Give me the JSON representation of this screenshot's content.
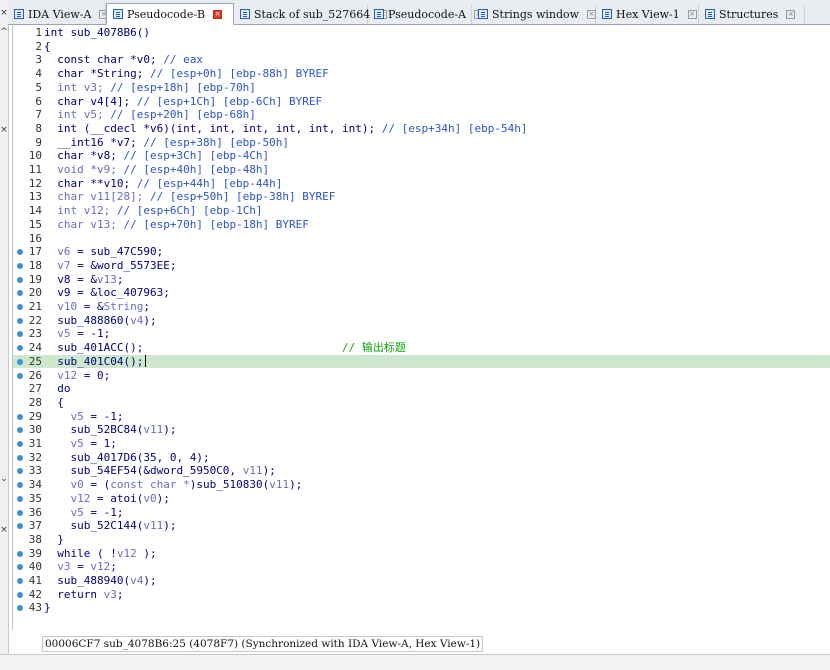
{
  "left_marks": [
    "×",
    "^",
    "×",
    "⌄",
    "×"
  ],
  "tabs": [
    {
      "label": "IDA View-A",
      "active": false
    },
    {
      "label": "Pseudocode-B",
      "active": true
    },
    {
      "label": "Stack of sub_527664",
      "active": false
    },
    {
      "label": "Pseudocode-A",
      "active": false
    },
    {
      "label": "Strings window",
      "active": false
    },
    {
      "label": "Hex View-1",
      "active": false
    },
    {
      "label": "Structures",
      "active": false
    }
  ],
  "code_lines": [
    {
      "n": "1",
      "dot": false,
      "segs": [
        [
          "d",
          "int sub_4078B6()"
        ]
      ]
    },
    {
      "n": "2",
      "dot": false,
      "segs": [
        [
          "d",
          "{"
        ]
      ]
    },
    {
      "n": "3",
      "dot": false,
      "segs": [
        [
          "d",
          "  const char *v0; "
        ],
        [
          "c",
          "// eax"
        ]
      ]
    },
    {
      "n": "4",
      "dot": false,
      "segs": [
        [
          "d",
          "  char *String; "
        ],
        [
          "c",
          "// [esp+0h] [ebp-88h] BYREF"
        ]
      ]
    },
    {
      "n": "5",
      "dot": false,
      "segs": [
        [
          "v",
          "  int v3; "
        ],
        [
          "c",
          "// [esp+18h] [ebp-70h]"
        ]
      ]
    },
    {
      "n": "6",
      "dot": false,
      "segs": [
        [
          "d",
          "  char v4[4]; "
        ],
        [
          "c",
          "// [esp+1Ch] [ebp-6Ch] BYREF"
        ]
      ]
    },
    {
      "n": "7",
      "dot": false,
      "segs": [
        [
          "v",
          "  int v5; "
        ],
        [
          "c",
          "// [esp+20h] [ebp-68h]"
        ]
      ]
    },
    {
      "n": "8",
      "dot": false,
      "segs": [
        [
          "d",
          "  int (__cdecl *v6)(int, int, int, int, int, int); "
        ],
        [
          "c",
          "// [esp+34h] [ebp-54h]"
        ]
      ]
    },
    {
      "n": "9",
      "dot": false,
      "segs": [
        [
          "d",
          "  __int16 *v7; "
        ],
        [
          "c",
          "// [esp+38h] [ebp-50h]"
        ]
      ]
    },
    {
      "n": "10",
      "dot": false,
      "segs": [
        [
          "d",
          "  char *v8; "
        ],
        [
          "c",
          "// [esp+3Ch] [ebp-4Ch]"
        ]
      ]
    },
    {
      "n": "11",
      "dot": false,
      "segs": [
        [
          "v",
          "  void *v9; "
        ],
        [
          "c",
          "// [esp+40h] [ebp-48h]"
        ]
      ]
    },
    {
      "n": "12",
      "dot": false,
      "segs": [
        [
          "d",
          "  char **v10; "
        ],
        [
          "c",
          "// [esp+44h] [ebp-44h]"
        ]
      ]
    },
    {
      "n": "13",
      "dot": false,
      "segs": [
        [
          "v",
          "  char v11[28]; "
        ],
        [
          "c",
          "// [esp+50h] [ebp-38h] BYREF"
        ]
      ]
    },
    {
      "n": "14",
      "dot": false,
      "segs": [
        [
          "v",
          "  int v12; "
        ],
        [
          "c",
          "// [esp+6Ch] [ebp-1Ch]"
        ]
      ]
    },
    {
      "n": "15",
      "dot": false,
      "segs": [
        [
          "v",
          "  char v13; "
        ],
        [
          "c",
          "// [esp+70h] [ebp-18h] BYREF"
        ]
      ]
    },
    {
      "n": "16",
      "dot": false,
      "segs": [
        [
          "d",
          ""
        ]
      ]
    },
    {
      "n": "17",
      "dot": true,
      "segs": [
        [
          "v",
          "  v6"
        ],
        [
          "d",
          " = sub_47C590;"
        ]
      ]
    },
    {
      "n": "18",
      "dot": true,
      "segs": [
        [
          "v",
          "  v7"
        ],
        [
          "d",
          " = &word_5573EE;"
        ]
      ]
    },
    {
      "n": "19",
      "dot": true,
      "segs": [
        [
          "d",
          "  v8 = &"
        ],
        [
          "v",
          "v13"
        ],
        [
          "d",
          ";"
        ]
      ]
    },
    {
      "n": "20",
      "dot": true,
      "segs": [
        [
          "d",
          "  v9 = &loc_407963;"
        ]
      ]
    },
    {
      "n": "21",
      "dot": true,
      "segs": [
        [
          "v",
          "  v10"
        ],
        [
          "d",
          " = &"
        ],
        [
          "v",
          "String"
        ],
        [
          "d",
          ";"
        ]
      ]
    },
    {
      "n": "22",
      "dot": true,
      "segs": [
        [
          "d",
          "  sub_488860("
        ],
        [
          "v",
          "v4"
        ],
        [
          "d",
          ");"
        ]
      ]
    },
    {
      "n": "23",
      "dot": true,
      "segs": [
        [
          "v",
          "  v5"
        ],
        [
          "d",
          " = -1;"
        ]
      ]
    },
    {
      "n": "24",
      "dot": true,
      "segs": [
        [
          "d",
          "  sub_401ACC();                              "
        ],
        [
          "x",
          "// 输出标题"
        ]
      ]
    },
    {
      "n": "25",
      "dot": true,
      "hl": true,
      "cursor": true,
      "segs": [
        [
          "d",
          "  sub_401C04();"
        ]
      ]
    },
    {
      "n": "26",
      "dot": true,
      "segs": [
        [
          "v",
          "  v12"
        ],
        [
          "d",
          " = 0;"
        ]
      ]
    },
    {
      "n": "27",
      "dot": false,
      "segs": [
        [
          "d",
          "  do"
        ]
      ]
    },
    {
      "n": "28",
      "dot": false,
      "segs": [
        [
          "d",
          "  {"
        ]
      ]
    },
    {
      "n": "29",
      "dot": true,
      "segs": [
        [
          "v",
          "    v5"
        ],
        [
          "d",
          " = -1;"
        ]
      ]
    },
    {
      "n": "30",
      "dot": true,
      "segs": [
        [
          "d",
          "    sub_52BC84("
        ],
        [
          "v",
          "v11"
        ],
        [
          "d",
          ");"
        ]
      ]
    },
    {
      "n": "31",
      "dot": true,
      "segs": [
        [
          "v",
          "    v5"
        ],
        [
          "d",
          " = 1;"
        ]
      ]
    },
    {
      "n": "32",
      "dot": true,
      "segs": [
        [
          "d",
          "    sub_4017D6(35, 0, 4);"
        ]
      ]
    },
    {
      "n": "33",
      "dot": true,
      "segs": [
        [
          "d",
          "    sub_54EF54(&dword_5950C0, "
        ],
        [
          "v",
          "v11"
        ],
        [
          "d",
          ");"
        ]
      ]
    },
    {
      "n": "34",
      "dot": true,
      "segs": [
        [
          "v",
          "    v0"
        ],
        [
          "d",
          " = ("
        ],
        [
          "v",
          "const char *"
        ],
        [
          "d",
          ")sub_510830("
        ],
        [
          "v",
          "v11"
        ],
        [
          "d",
          ");"
        ]
      ]
    },
    {
      "n": "35",
      "dot": true,
      "segs": [
        [
          "v",
          "    v12"
        ],
        [
          "d",
          " = atoi("
        ],
        [
          "v",
          "v0"
        ],
        [
          "d",
          ");"
        ]
      ]
    },
    {
      "n": "36",
      "dot": true,
      "segs": [
        [
          "v",
          "    v5"
        ],
        [
          "d",
          " = -1;"
        ]
      ]
    },
    {
      "n": "37",
      "dot": true,
      "segs": [
        [
          "d",
          "    sub_52C144("
        ],
        [
          "v",
          "v11"
        ],
        [
          "d",
          ");"
        ]
      ]
    },
    {
      "n": "38",
      "dot": false,
      "segs": [
        [
          "d",
          "  }"
        ]
      ]
    },
    {
      "n": "39",
      "dot": true,
      "segs": [
        [
          "d",
          "  while ( !"
        ],
        [
          "v",
          "v12"
        ],
        [
          "d",
          " );"
        ]
      ]
    },
    {
      "n": "40",
      "dot": true,
      "segs": [
        [
          "v",
          "  v3"
        ],
        [
          "d",
          " = "
        ],
        [
          "v",
          "v12"
        ],
        [
          "d",
          ";"
        ]
      ]
    },
    {
      "n": "41",
      "dot": true,
      "segs": [
        [
          "d",
          "  sub_488940("
        ],
        [
          "v",
          "v4"
        ],
        [
          "d",
          ");"
        ]
      ]
    },
    {
      "n": "42",
      "dot": true,
      "segs": [
        [
          "d",
          "  return "
        ],
        [
          "v",
          "v3"
        ],
        [
          "d",
          ";"
        ]
      ]
    },
    {
      "n": "43",
      "dot": true,
      "segs": [
        [
          "d",
          "}"
        ]
      ]
    }
  ],
  "status": {
    "text": "00006CF7 sub_4078B6:25 (4078F7) (Synchronized with IDA View-A, Hex View-1)"
  },
  "colors": {
    "highlight": "#cde8cc",
    "breakpoint_dot": "#3b8fe0",
    "active_tab_close": "#d9412c"
  }
}
